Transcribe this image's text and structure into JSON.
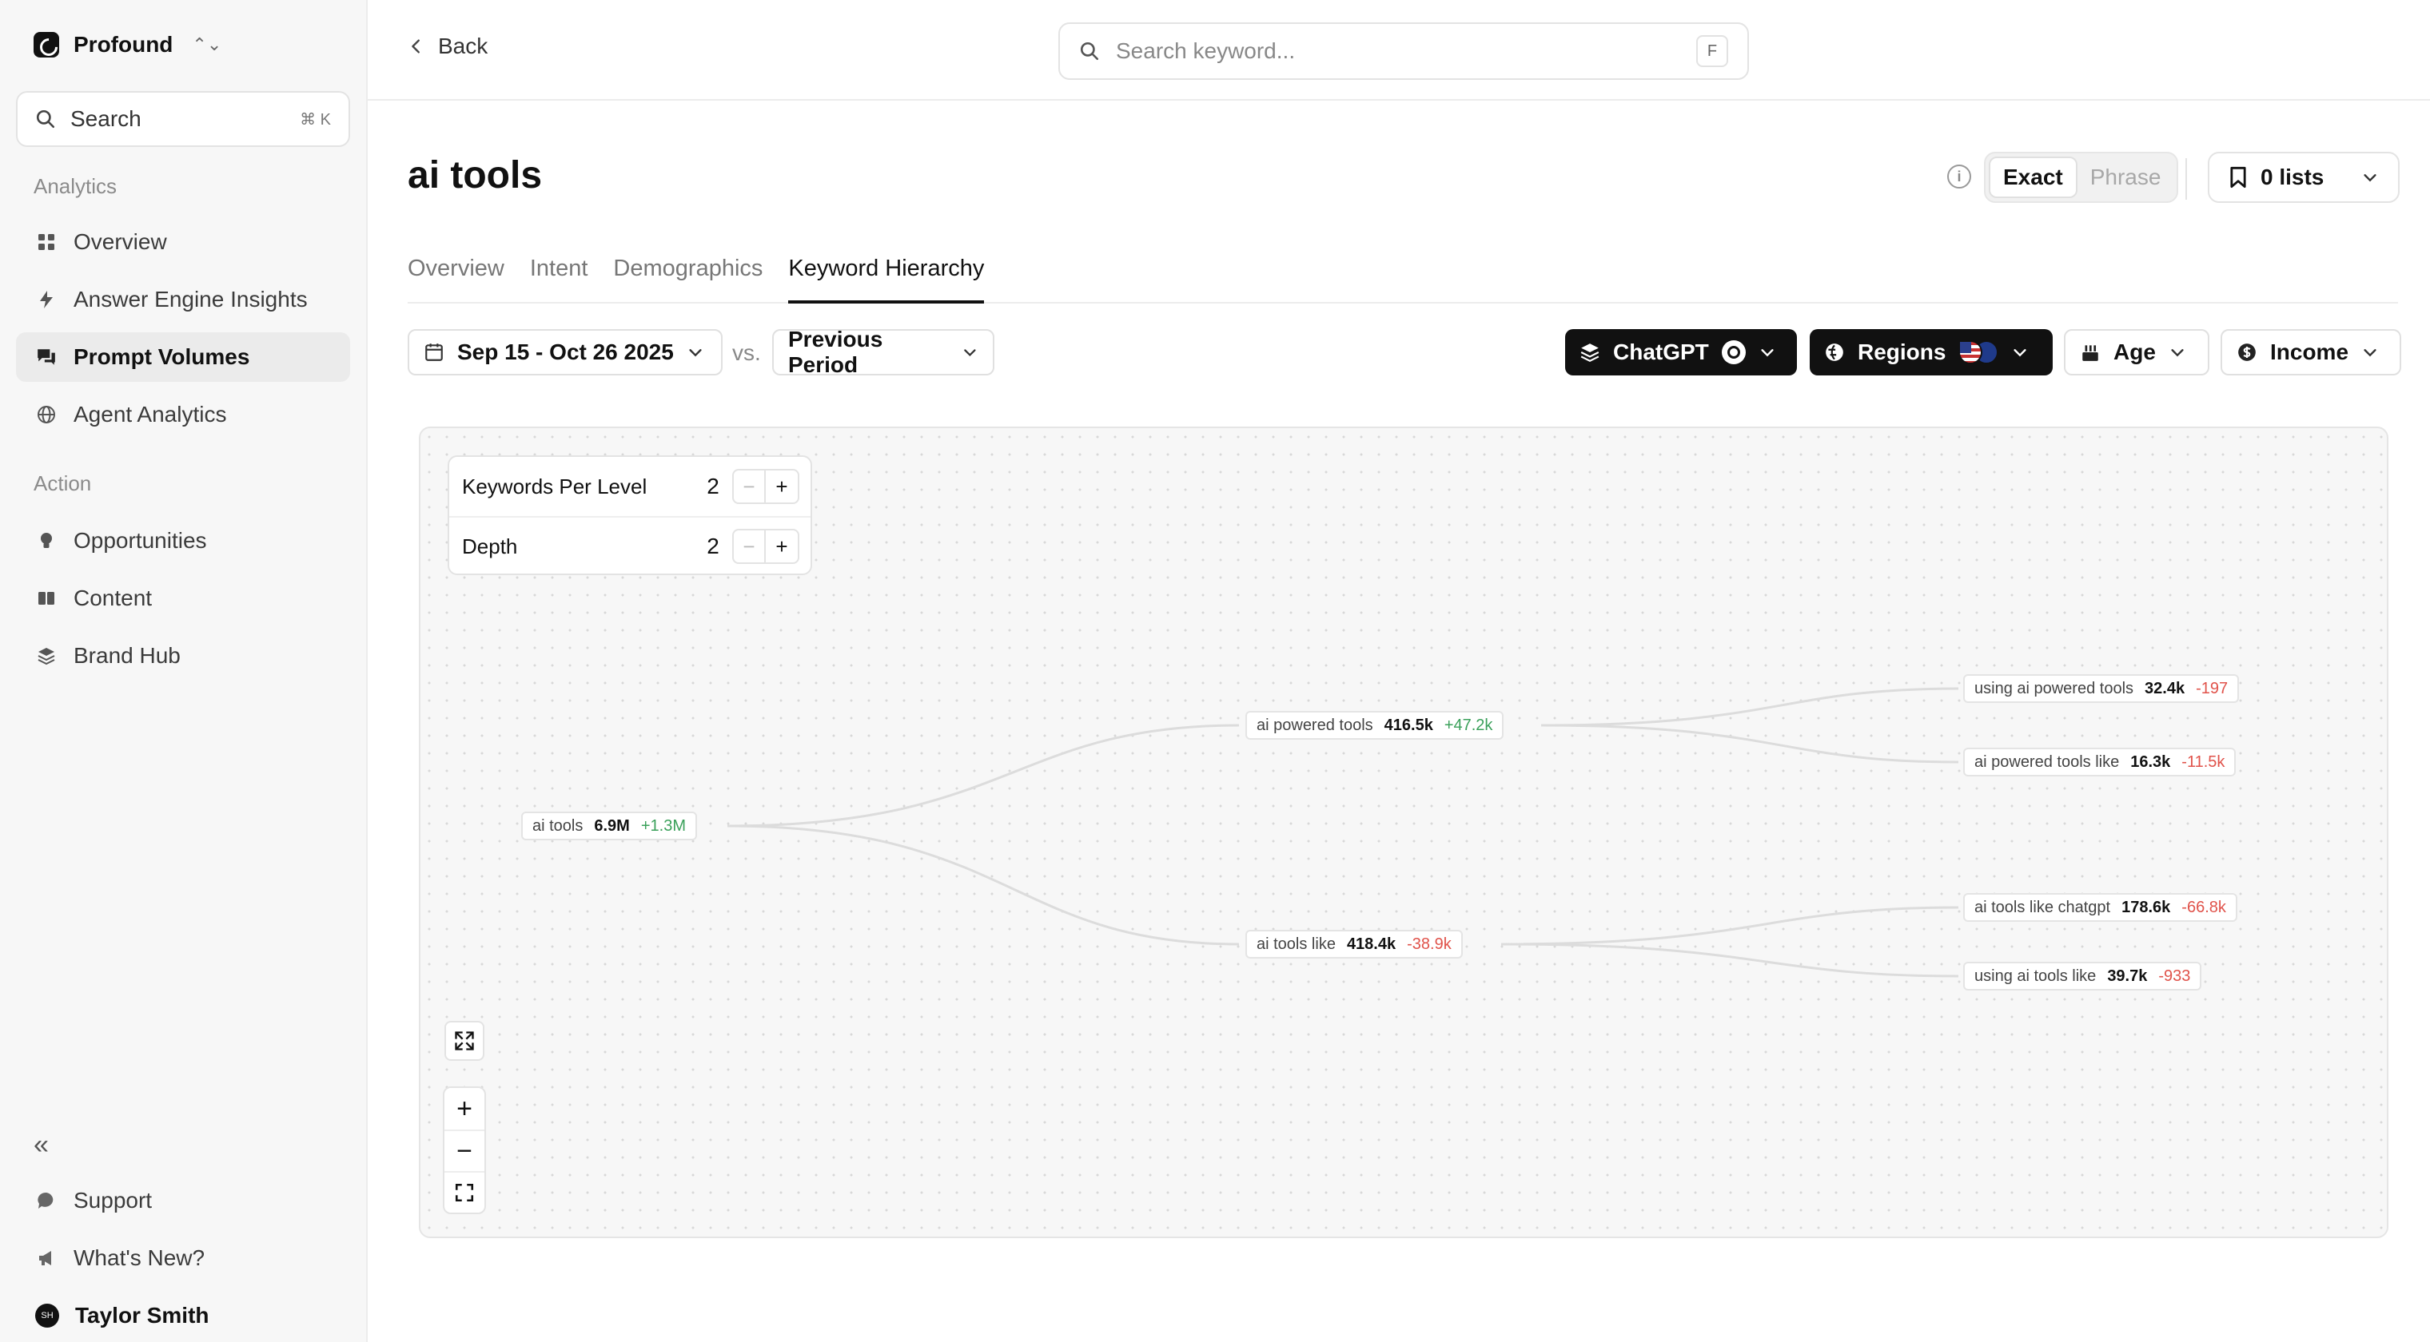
{
  "brand": {
    "name": "Profound"
  },
  "sidebar": {
    "search_label": "Search",
    "search_shortcut": "⌘ K",
    "sections": [
      {
        "label": "Analytics",
        "items": [
          "Overview",
          "Answer Engine Insights",
          "Prompt Volumes",
          "Agent Analytics"
        ]
      },
      {
        "label": "Action",
        "items": [
          "Opportunities",
          "Content",
          "Brand Hub"
        ]
      }
    ],
    "active_item": "Prompt Volumes",
    "footer": {
      "support": "Support",
      "whats_new": "What's New?",
      "user_name": "Taylor Smith",
      "user_initials": "SH"
    }
  },
  "topbar": {
    "back_label": "Back",
    "search_placeholder": "Search keyword...",
    "search_shortcut": "F"
  },
  "page": {
    "title": "ai tools",
    "match_options": [
      "Exact",
      "Phrase"
    ],
    "match_selected": "Exact",
    "lists_label": "0 lists",
    "tabs": [
      "Overview",
      "Intent",
      "Demographics",
      "Keyword Hierarchy"
    ],
    "active_tab": "Keyword Hierarchy"
  },
  "filters": {
    "date_range": "Sep 15 - Oct 26 2025",
    "vs_label": "vs.",
    "compare": "Previous Period",
    "engine": "ChatGPT",
    "regions": "Regions",
    "age": "Age",
    "income": "Income"
  },
  "controls": {
    "keywords_per_level_label": "Keywords Per Level",
    "keywords_per_level": "2",
    "depth_label": "Depth",
    "depth": "2"
  },
  "tree": {
    "root": {
      "keyword": "ai tools",
      "volume": "6.9M",
      "change": "+1.3M",
      "trend": "up"
    },
    "level1": [
      {
        "keyword": "ai powered tools",
        "volume": "416.5k",
        "change": "+47.2k",
        "trend": "up"
      },
      {
        "keyword": "ai tools like",
        "volume": "418.4k",
        "change": "-38.9k",
        "trend": "down"
      }
    ],
    "level2": [
      {
        "keyword": "using ai powered tools",
        "volume": "32.4k",
        "change": "-197",
        "trend": "down"
      },
      {
        "keyword": "ai powered tools like",
        "volume": "16.3k",
        "change": "-11.5k",
        "trend": "down"
      },
      {
        "keyword": "ai tools like chatgpt",
        "volume": "178.6k",
        "change": "-66.8k",
        "trend": "down"
      },
      {
        "keyword": "using ai tools like",
        "volume": "39.7k",
        "change": "-933",
        "trend": "down"
      }
    ]
  },
  "colors": {
    "accent": "#111111",
    "positive": "#3aa05a",
    "negative": "#e0524a"
  }
}
